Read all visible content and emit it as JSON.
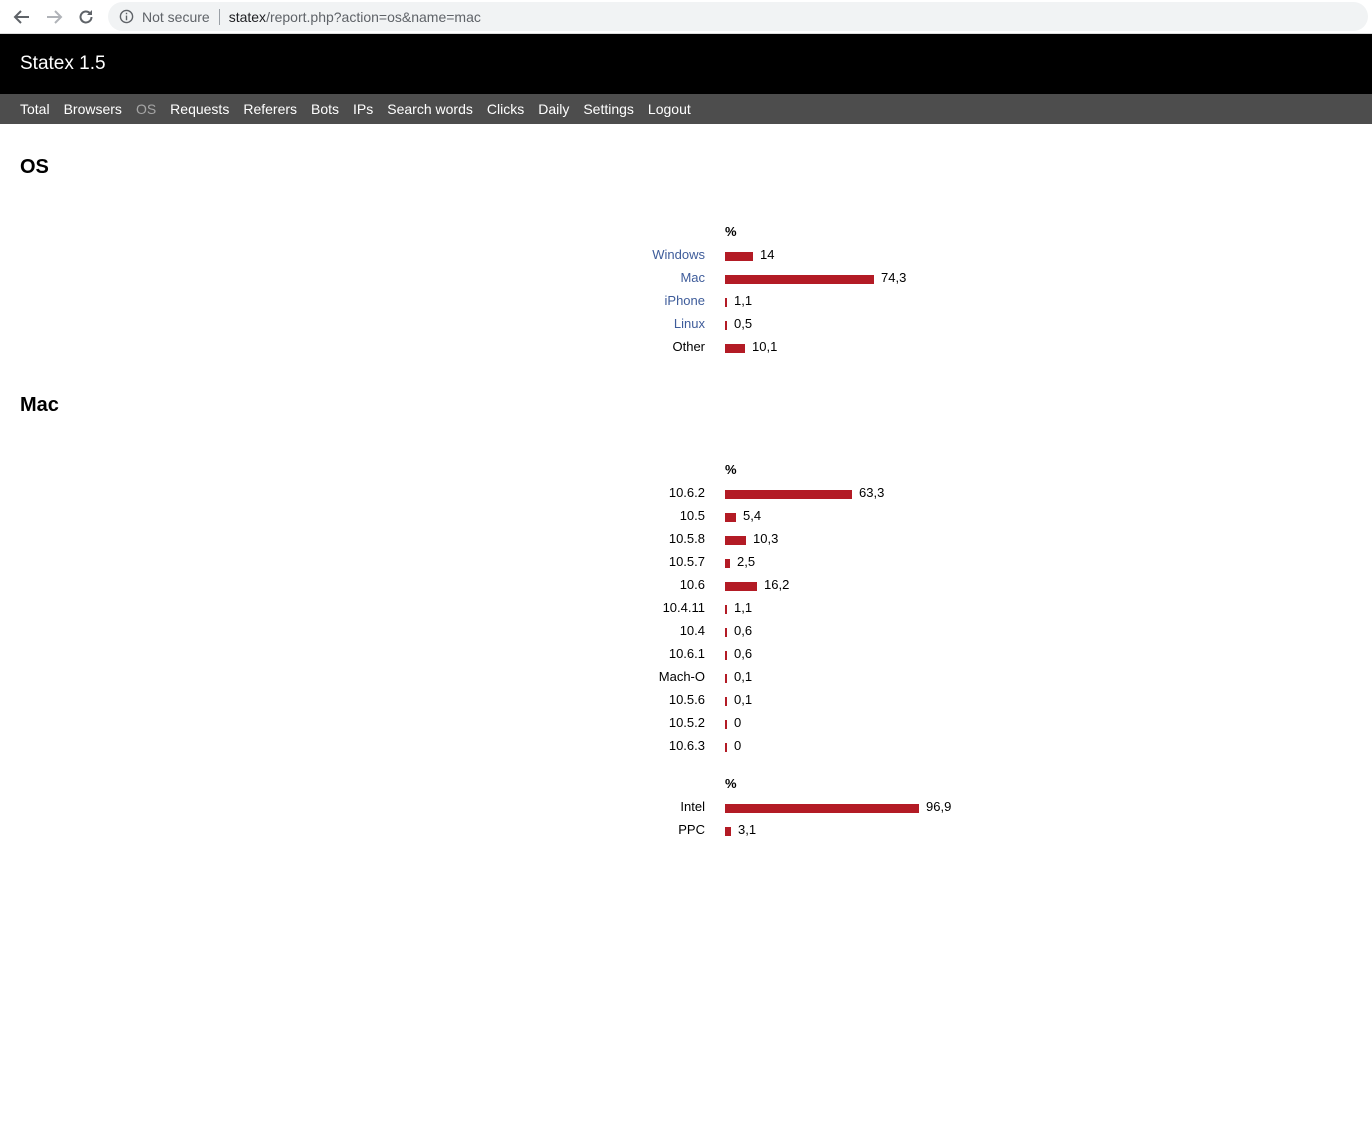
{
  "browser": {
    "security_label": "Not secure",
    "url_host": "statex",
    "url_path": "/report.php?action=os&name=mac"
  },
  "app": {
    "title": "Statex 1.5",
    "nav": [
      "Total",
      "Browsers",
      "OS",
      "Requests",
      "Referers",
      "Bots",
      "IPs",
      "Search words",
      "Clicks",
      "Daily",
      "Settings",
      "Logout"
    ],
    "active_nav": "OS"
  },
  "colors": {
    "bar": "#b31b25",
    "link": "#3e5c9a"
  },
  "sections": [
    {
      "heading": "OS",
      "tables": [
        {
          "header": "%",
          "rows": [
            {
              "label": "Windows",
              "value": "14",
              "pct": 14,
              "link": true
            },
            {
              "label": "Mac",
              "value": "74,3",
              "pct": 74.3,
              "link": true
            },
            {
              "label": "iPhone",
              "value": "1,1",
              "pct": 1.1,
              "link": true
            },
            {
              "label": "Linux",
              "value": "0,5",
              "pct": 0.5,
              "link": true
            },
            {
              "label": "Other",
              "value": "10,1",
              "pct": 10.1,
              "link": false
            }
          ]
        }
      ]
    },
    {
      "heading": "Mac",
      "tables": [
        {
          "header": "%",
          "rows": [
            {
              "label": "10.6.2",
              "value": "63,3",
              "pct": 63.3
            },
            {
              "label": "10.5",
              "value": "5,4",
              "pct": 5.4
            },
            {
              "label": "10.5.8",
              "value": "10,3",
              "pct": 10.3
            },
            {
              "label": "10.5.7",
              "value": "2,5",
              "pct": 2.5
            },
            {
              "label": "10.6",
              "value": "16,2",
              "pct": 16.2
            },
            {
              "label": "10.4.11",
              "value": "1,1",
              "pct": 1.1
            },
            {
              "label": "10.4",
              "value": "0,6",
              "pct": 0.6
            },
            {
              "label": "10.6.1",
              "value": "0,6",
              "pct": 0.6
            },
            {
              "label": "Mach-O",
              "value": "0,1",
              "pct": 0.1
            },
            {
              "label": "10.5.6",
              "value": "0,1",
              "pct": 0.1
            },
            {
              "label": "10.5.2",
              "value": "0",
              "pct": 0
            },
            {
              "label": "10.6.3",
              "value": "0",
              "pct": 0
            }
          ]
        },
        {
          "header": "%",
          "rows": [
            {
              "label": "Intel",
              "value": "96,9",
              "pct": 96.9
            },
            {
              "label": "PPC",
              "value": "3,1",
              "pct": 3.1
            }
          ]
        }
      ]
    }
  ]
}
